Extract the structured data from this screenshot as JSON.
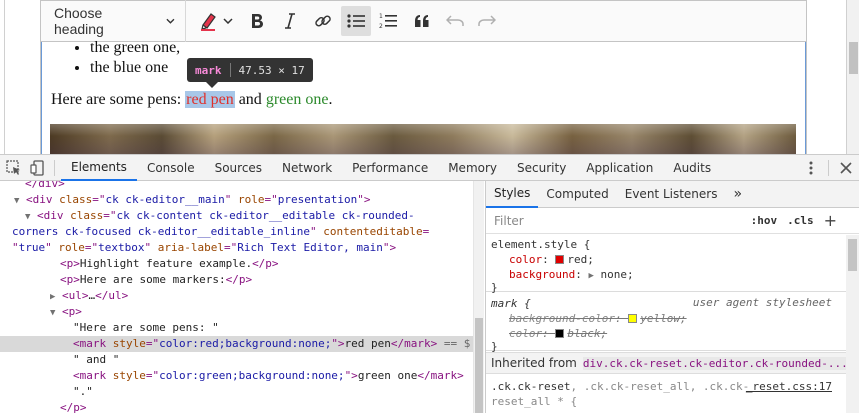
{
  "editor": {
    "toolbar": {
      "heading_label": "Choose heading"
    },
    "list_items": [
      "the green one,",
      "the blue one"
    ],
    "pens_line": {
      "prefix": "Here are some pens: ",
      "red_mark": "red pen",
      "middle": " and ",
      "green_mark": "green one",
      "suffix": "."
    },
    "tooltip": {
      "tag": "mark",
      "size": "47.53 × 17"
    }
  },
  "devtools": {
    "tabs": [
      "Elements",
      "Console",
      "Sources",
      "Network",
      "Performance",
      "Memory",
      "Security",
      "Application",
      "Audits"
    ],
    "active_tab": "Elements",
    "dom": {
      "l0_close": "</div>",
      "main_tag": "div",
      "main_class": "ck ck-editor__main",
      "main_role": "presentation",
      "content_class_1": "ck ck-content ck-editor__editable ck-rounded-",
      "content_class_2": "corners ck-focused ck-editor__editable_inline",
      "content_editable": "true",
      "content_role": "textbox",
      "content_aria": "Rich Text Editor, main",
      "p1_text": "Highlight feature example.",
      "p2_text": "Here are some markers:",
      "ul_collapsed": "…",
      "text1": "\"Here are some pens: \"",
      "mark1_style": "color:red;background:none;",
      "mark1_text": "red pen",
      "selected_suffix": " == $",
      "text2": "\" and \"",
      "mark2_style": "color:green;background:none;",
      "mark2_text": "green one",
      "text3": "\".\""
    },
    "styles": {
      "tabs": [
        "Styles",
        "Computed",
        "Event Listeners"
      ],
      "more": "»",
      "filter_placeholder": "Filter",
      "hov": ":hov",
      "cls": ".cls",
      "element_style_selector": "element.style",
      "color_prop": "color",
      "color_val": "red",
      "bg_prop": "background",
      "bg_val": "none",
      "mark_selector": "mark",
      "ua_label": "user agent stylesheet",
      "ua_bg_prop": "background-color",
      "ua_bg_val": "yellow",
      "ua_color_prop": "color",
      "ua_color_val": "black",
      "inherited_label": "Inherited from",
      "inherited_node": "div.ck.ck-reset.ck-editor.ck-rounded-...",
      "reset_selector_1": ".ck.ck-reset",
      "reset_selector_2": ", .ck.ck-reset_all, .ck.ck-",
      "reset_selector_3": "reset_all * {",
      "reset_source": "_reset.css:17"
    },
    "colors": {
      "red_swatch": "#e00000",
      "yellow_swatch": "#ffff00",
      "black_swatch": "#000000"
    }
  }
}
